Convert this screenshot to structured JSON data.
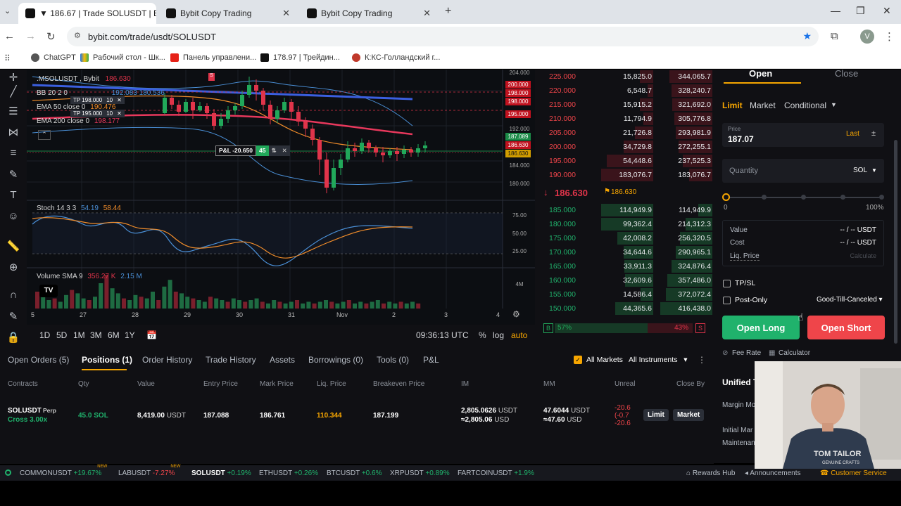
{
  "browser": {
    "tabs": [
      {
        "title": "▼ 186.67 | Trade SOLUSDT | By",
        "active": true
      },
      {
        "title": "Bybit Copy Trading",
        "active": false
      },
      {
        "title": "Bybit Copy Trading",
        "active": false
      }
    ],
    "new_tab": "+",
    "url": "bybit.com/trade/usdt/SOLUSDT",
    "profile": "V",
    "bookmarks": [
      "ChatGPT",
      "Рабочий стол - Шк...",
      "Панель управлени...",
      "178.97 | Трейдин...",
      "К:КС-Голландский г..."
    ]
  },
  "chart": {
    "symbol_legend": ".MSOLUSDT , Bybit",
    "symbol_price": "186.630",
    "bb_label": "BB 20 2 0",
    "bb_values": "192.083  180.536",
    "ema50_label": "EMA 50 close 0",
    "ema50_value": "190.476",
    "ema200_label": "EMA 200 close 0",
    "ema200_value": "198.177",
    "tp1": "TP 198.000",
    "tp1_qty": "10",
    "tp2": "TP 195.000",
    "tp2_qty": "10",
    "pnl": "P&L -20.650",
    "pnl_qty": "45",
    "stoch_label": "Stoch 14 3 3",
    "stoch_k": "54.19",
    "stoch_d": "58.44",
    "volume_label": "Volume SMA 9",
    "volume_v1": "356.27 K",
    "volume_v2": "2.15 M",
    "y_labels_main": [
      "204.000",
      "200.000",
      "198.000",
      "198.000",
      "195.000",
      "192.000",
      "187.089",
      "186.630",
      "186.630",
      "184.000",
      "180.000"
    ],
    "y_labels_stoch": [
      "75.00",
      "50.00",
      "25.00"
    ],
    "y_label_vol": "4M",
    "x_labels": [
      "5",
      "27",
      "28",
      "29",
      "30",
      "31",
      "Nov",
      "2",
      "3",
      "4"
    ],
    "timeframes": [
      "1D",
      "5D",
      "1M",
      "3M",
      "6M",
      "1Y"
    ],
    "time": "09:36:13 UTC",
    "scale_opts": [
      "%",
      "log",
      "auto"
    ],
    "colors": {
      "up": "#21a85a",
      "down": "#e0344a",
      "ema200": "#e8385c",
      "ema50": "#f08c2a",
      "bb": "#4a8fd6",
      "blue_line": "#3b5fe0"
    }
  },
  "orderbook": {
    "asks": [
      {
        "price": "225.000",
        "qty": "15,825.0",
        "total": "344,065.7"
      },
      {
        "price": "220.000",
        "qty": "6,548.7",
        "total": "328,240.7"
      },
      {
        "price": "215.000",
        "qty": "15,915.2",
        "total": "321,692.0"
      },
      {
        "price": "210.000",
        "qty": "11,794.9",
        "total": "305,776.8"
      },
      {
        "price": "205.000",
        "qty": "21,726.8",
        "total": "293,981.9"
      },
      {
        "price": "200.000",
        "qty": "34,729.8",
        "total": "272,255.1"
      },
      {
        "price": "195.000",
        "qty": "54,448.6",
        "total": "237,525.3"
      },
      {
        "price": "190.000",
        "qty": "183,076.7",
        "total": "183,076.7"
      }
    ],
    "last_price": "186.630",
    "mark_price": "186.630",
    "bids": [
      {
        "price": "185.000",
        "qty": "114,949.9",
        "total": "114,949.9"
      },
      {
        "price": "180.000",
        "qty": "99,362.4",
        "total": "214,312.3"
      },
      {
        "price": "175.000",
        "qty": "42,008.2",
        "total": "256,320.5"
      },
      {
        "price": "170.000",
        "qty": "34,644.6",
        "total": "290,965.1"
      },
      {
        "price": "165.000",
        "qty": "33,911.3",
        "total": "324,876.4"
      },
      {
        "price": "160.000",
        "qty": "32,609.6",
        "total": "357,486.0"
      },
      {
        "price": "155.000",
        "qty": "14,586.4",
        "total": "372,072.4"
      },
      {
        "price": "150.000",
        "qty": "44,365.6",
        "total": "416,438.0"
      }
    ],
    "buy_badge": "B",
    "buy_pct": "57%",
    "sell_pct": "43%",
    "sell_badge": "S"
  },
  "trade": {
    "tab_open": "Open",
    "tab_close": "Close",
    "order_types": [
      "Limit",
      "Market",
      "Conditional"
    ],
    "price_label": "Price",
    "price_value": "187.07",
    "last_label": "Last",
    "quantity_label": "Quantity",
    "quantity_unit": "SOL",
    "slider_min": "0",
    "slider_max": "100%",
    "value_label": "Value",
    "value_val": "-- / -- USDT",
    "cost_label": "Cost",
    "cost_val": "-- / -- USDT",
    "liq_label": "Liq. Price",
    "liq_val": "Calculate",
    "tpsl_label": "TP/SL",
    "postonly_label": "Post-Only",
    "tif": "Good-Till-Canceled",
    "open_long": "Open Long",
    "open_short": "Open Short",
    "fee_rate": "Fee Rate",
    "calculator": "Calculator",
    "unified": "Unified T",
    "margin_mode": "Margin Mo",
    "initial_margin": "Initial Mar",
    "maintenance": "Maintenan"
  },
  "positions": {
    "tabs": [
      "Open Orders (5)",
      "Positions (1)",
      "Order History",
      "Trade History",
      "Assets",
      "Borrowings (0)",
      "Tools (0)",
      "P&L"
    ],
    "all_markets": "All Markets",
    "all_instruments": "All Instruments",
    "columns": [
      "Contracts",
      "Qty",
      "Value",
      "Entry Price",
      "Mark Price",
      "Liq. Price",
      "Breakeven Price",
      "IM",
      "MM",
      "Unreal",
      "Close By"
    ],
    "row": {
      "contract": "SOLUSDT",
      "perp": "Perp",
      "cross": "Cross 3.00x",
      "qty": "45.0 SOL",
      "value": "8,419.00",
      "value_unit": "USDT",
      "entry": "187.088",
      "mark": "186.761",
      "liq": "110.344",
      "breakeven": "187.199",
      "im1": "2,805.0626",
      "im1_unit": "USDT",
      "im2": "≈2,805.06",
      "im2_unit": "USD",
      "mm1": "47.6044",
      "mm1_unit": "USDT",
      "mm2": "≈47.60",
      "mm2_unit": "USD",
      "unreal1": "-20.6",
      "unreal2": "(-0.7",
      "unreal3": "-20.6",
      "close_limit": "Limit",
      "close_market": "Market"
    }
  },
  "ticker": [
    {
      "sym": "COMMONUSDT",
      "chg": "+19.67%",
      "dir": "up",
      "new": true
    },
    {
      "sym": "LABUSDT",
      "chg": "-7.27%",
      "dir": "down",
      "new": true
    },
    {
      "sym": "SOLUSDT",
      "chg": "+0.19%",
      "dir": "up",
      "new": false
    },
    {
      "sym": "ETHUSDT",
      "chg": "+0.26%",
      "dir": "up",
      "new": false
    },
    {
      "sym": "BTCUSDT",
      "chg": "+0.6%",
      "dir": "up",
      "new": false
    },
    {
      "sym": "XRPUSDT",
      "chg": "+0.89%",
      "dir": "up",
      "new": false
    },
    {
      "sym": "FARTCOINUSDT",
      "chg": "+1.9%",
      "dir": "up",
      "new": false
    }
  ],
  "ticker_new": "NEW",
  "footer": {
    "rewards": "Rewards Hub",
    "announcements": "Announcements",
    "customer_service": "Customer Service"
  },
  "webcam": {
    "shirt_text": "TOM TAILOR",
    "shirt_sub": "GENUINE CRAFTS"
  }
}
